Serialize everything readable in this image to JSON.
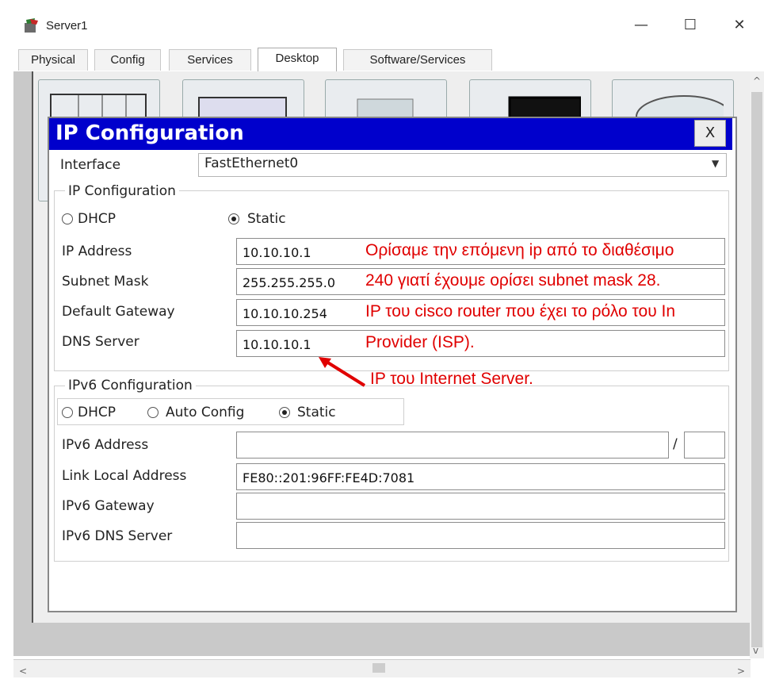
{
  "window": {
    "title": "Server1",
    "minimize": "—",
    "maximize": "☐",
    "close": "✕"
  },
  "tabs": [
    "Physical",
    "Config",
    "Services",
    "Desktop",
    "Software/Services"
  ],
  "active_tab": "Desktop",
  "dialog": {
    "title": "IP Configuration",
    "close_label": "X",
    "interface_label": "Interface",
    "interface_value": "FastEthernet0",
    "ipv4_group": {
      "legend": "IP Configuration",
      "dhcp_label": "DHCP",
      "static_label": "Static",
      "selected": "Static",
      "fields": [
        {
          "label": "IP Address",
          "value": "10.10.10.1"
        },
        {
          "label": "Subnet Mask",
          "value": "255.255.255.0"
        },
        {
          "label": "Default Gateway",
          "value": "10.10.10.254"
        },
        {
          "label": "DNS Server",
          "value": "10.10.10.1"
        }
      ]
    },
    "ipv6_group": {
      "legend": "IPv6 Configuration",
      "dhcp_label": "DHCP",
      "auto_label": "Auto Config",
      "static_label": "Static",
      "selected": "Static",
      "address_label": "IPv6 Address",
      "address_value": "",
      "prefix_sep": "/",
      "prefix_value": "",
      "link_local_label": "Link Local Address",
      "link_local_value": "FE80::201:96FF:FE4D:7081",
      "gateway_label": "IPv6 Gateway",
      "gateway_value": "",
      "dns_label": "IPv6 DNS Server",
      "dns_value": ""
    }
  },
  "annotations": {
    "color": "#e00000",
    "line1": "Ορίσαμε την επόμενη ip από το διαθέσιμο",
    "line2": "240 γιατί έχουμε ορίσει subnet mask 28.",
    "line3": "IP του cisco router που έχει το ρόλο του In",
    "line4": "Provider (ISP).",
    "line5": "IP του Internet Server."
  },
  "colors": {
    "dialog_header": "#0000cc",
    "desktop_bg": "#c9c9c9"
  }
}
